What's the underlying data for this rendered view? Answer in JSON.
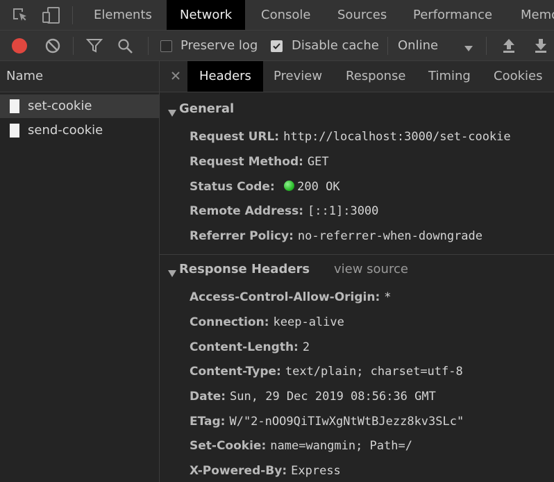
{
  "tabs": [
    "Elements",
    "Network",
    "Console",
    "Sources",
    "Performance",
    "Memory"
  ],
  "toolbar": {
    "preserve_log": "Preserve log",
    "disable_cache": "Disable cache",
    "throttle": "Online",
    "preserve_checked": false,
    "disable_checked": true
  },
  "left": {
    "header": "Name",
    "requests": [
      "set-cookie",
      "send-cookie"
    ]
  },
  "subtabs": [
    "Headers",
    "Preview",
    "Response",
    "Timing",
    "Cookies"
  ],
  "general": {
    "title": "General",
    "rows": [
      {
        "k": "Request URL:",
        "v": "http://localhost:3000/set-cookie"
      },
      {
        "k": "Request Method:",
        "v": "GET"
      },
      {
        "k": "Status Code:",
        "v": "200 OK"
      },
      {
        "k": "Remote Address:",
        "v": "[::1]:3000"
      },
      {
        "k": "Referrer Policy:",
        "v": "no-referrer-when-downgrade"
      }
    ]
  },
  "response_headers": {
    "title": "Response Headers",
    "view_source": "view source",
    "rows": [
      {
        "k": "Access-Control-Allow-Origin:",
        "v": "*"
      },
      {
        "k": "Connection:",
        "v": "keep-alive"
      },
      {
        "k": "Content-Length:",
        "v": "2"
      },
      {
        "k": "Content-Type:",
        "v": "text/plain; charset=utf-8"
      },
      {
        "k": "Date:",
        "v": "Sun, 29 Dec 2019 08:56:36 GMT"
      },
      {
        "k": "ETag:",
        "v": "W/\"2-nOO9QiTIwXgNtWtBJezz8kv3SLc\""
      },
      {
        "k": "Set-Cookie:",
        "v": "name=wangmin; Path=/"
      },
      {
        "k": "X-Powered-By:",
        "v": "Express"
      }
    ]
  },
  "colors": {
    "record": "#e0473f",
    "status_ok": "#2bbd2b"
  }
}
